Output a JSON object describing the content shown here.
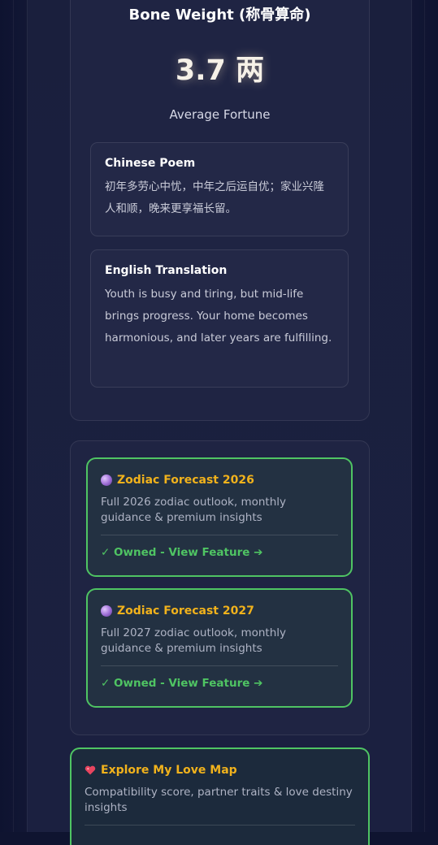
{
  "bone_weight": {
    "title": "Bone Weight (称骨算命)",
    "weight": "3.7 两",
    "fortune": "Average Fortune",
    "poem": {
      "heading": "Chinese Poem",
      "text": "初年多劳心中忧，中年之后运自优；家业兴隆人和顺，晚来更享福长留。"
    },
    "translation": {
      "heading": "English Translation",
      "text": "Youth is busy and tiring, but mid-life brings progress. Your home becomes harmonious, and later years are fulfilling."
    }
  },
  "features": [
    {
      "icon": "crystal-ball-icon",
      "title": "Zodiac Forecast 2026",
      "description": "Full 2026 zodiac outlook, monthly guidance & premium insights",
      "status": "✓ Owned - View Feature ➔"
    },
    {
      "icon": "crystal-ball-icon",
      "title": "Zodiac Forecast 2027",
      "description": "Full 2027 zodiac outlook, monthly guidance & premium insights",
      "status": "✓ Owned - View Feature ➔"
    }
  ],
  "love_map": {
    "icon": "sparkling-heart-icon",
    "title": "Explore My Love Map",
    "description": "Compatibility score, partner traits & love destiny insights"
  },
  "colors": {
    "accent_gold": "#f1b21c",
    "owned_green": "#4fc463",
    "background": "#191e3c"
  }
}
